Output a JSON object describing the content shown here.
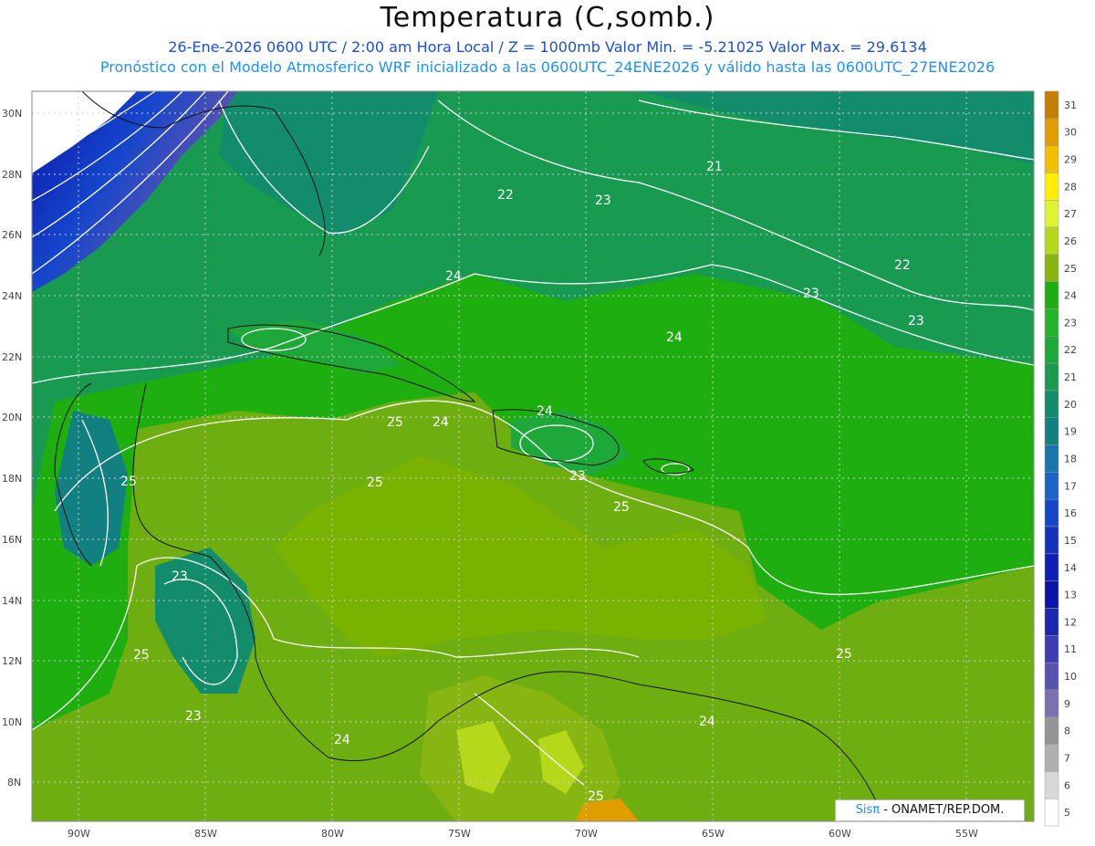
{
  "header": {
    "title": "Temperatura (C,somb.)",
    "subtitle1": "26-Ene-2026  0600 UTC / 2:00 am Hora Local / Z = 1000mb   Valor Min. = -5.21025  Valor Max. = 29.6134",
    "subtitle2": "Pronóstico con el Modelo Atmosferico WRF inicializado a las 0600UTC_24ENE2026 y válido hasta las  0600UTC_27ENE2026"
  },
  "map": {
    "lat_labels": [
      "30N",
      "28N",
      "26N",
      "24N",
      "22N",
      "20N",
      "18N",
      "16N",
      "14N",
      "12N",
      "10N",
      "8N"
    ],
    "lon_labels": [
      "90W",
      "85W",
      "80W",
      "75W",
      "70W",
      "65W",
      "60W",
      "55W"
    ],
    "contour_labels": [
      "21",
      "22",
      "23",
      "22",
      "24",
      "23",
      "23",
      "24",
      "25",
      "24",
      "24",
      "25",
      "23",
      "25",
      "23",
      "25",
      "25",
      "23",
      "25",
      "24",
      "24",
      "25"
    ]
  },
  "colorbar": {
    "levels": [
      "31",
      "30",
      "29",
      "28",
      "27",
      "26",
      "25",
      "24",
      "23",
      "22",
      "21",
      "20",
      "19",
      "18",
      "17",
      "16",
      "15",
      "14",
      "13",
      "12",
      "11",
      "10",
      "9",
      "8",
      "7",
      "6",
      "5"
    ],
    "colors": [
      "#c47f00",
      "#e09d00",
      "#f0c000",
      "#ffee00",
      "#dff233",
      "#b5d91a",
      "#87b512",
      "#1fae10",
      "#26b52a",
      "#1ea83a",
      "#189a50",
      "#128c6a",
      "#128080",
      "#1a76a8",
      "#1a63c8",
      "#1546cc",
      "#1232bb",
      "#0d1fb0",
      "#0a14a8",
      "#1c28b0",
      "#3c3cb4",
      "#5552b0",
      "#7d70b0",
      "#959595",
      "#b0b0b0",
      "#d8d8d8",
      "#ffffff"
    ]
  },
  "credit": {
    "sis": "Sisπ",
    "text": " - ONAMET/REP.DOM."
  }
}
